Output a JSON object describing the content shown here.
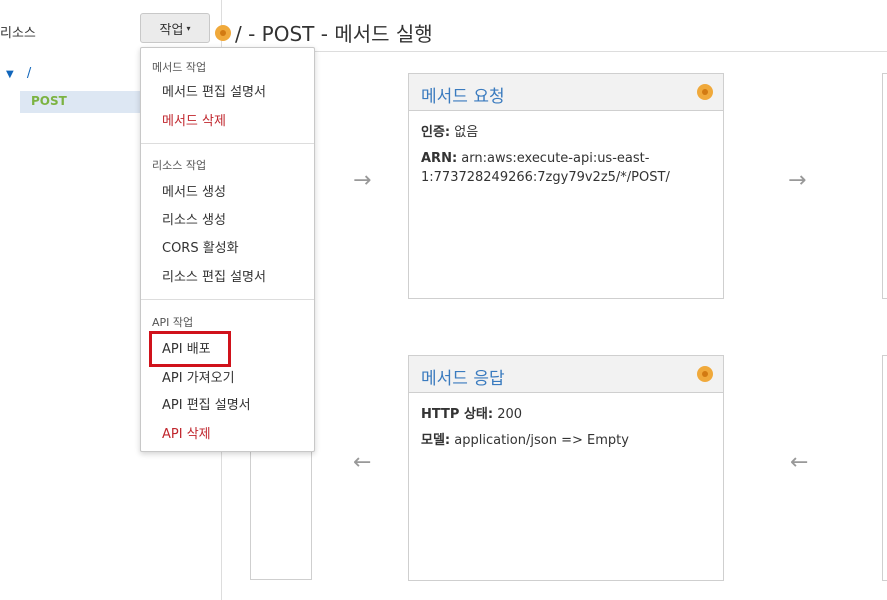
{
  "sidebar": {
    "title": "리소스",
    "tree": {
      "root_label": "/",
      "method_label": "POST"
    }
  },
  "header": {
    "actions_label": "작업",
    "title": "/ - POST - 메서드 실행"
  },
  "dropdown": {
    "sections": [
      {
        "heading": "메서드 작업",
        "items": [
          "메서드 편집 설명서",
          "메서드 삭제"
        ]
      },
      {
        "heading": "리소스 작업",
        "items": [
          "메서드 생성",
          "리소스 생성",
          "CORS 활성화",
          "리소스 편집 설명서"
        ]
      },
      {
        "heading": "API 작업",
        "items": [
          "API 배포",
          "API 가져오기",
          "API 편집 설명서",
          "API 삭제"
        ]
      }
    ]
  },
  "method_request": {
    "title": "메서드 요청",
    "auth_label": "인증:",
    "auth_value": "없음",
    "arn_label": "ARN:",
    "arn_value": "arn:aws:execute-api:us-east-1:773728249266:7zgy79v2z5/*/POST/"
  },
  "method_response": {
    "title": "메서드 응답",
    "status_label": "HTTP 상태:",
    "status_value": "200",
    "model_label": "모델:",
    "model_value": "application/json => Empty"
  },
  "colors": {
    "accent": "#3a7bbf",
    "danger": "#c0262d",
    "method_green": "#7cb342",
    "highlight_red": "#d0121b",
    "status_dot": "#f0a93b"
  },
  "icons": {
    "arrow_right": "→",
    "arrow_left": "←",
    "caret_down": "▼",
    "triangle_down": "▾"
  }
}
